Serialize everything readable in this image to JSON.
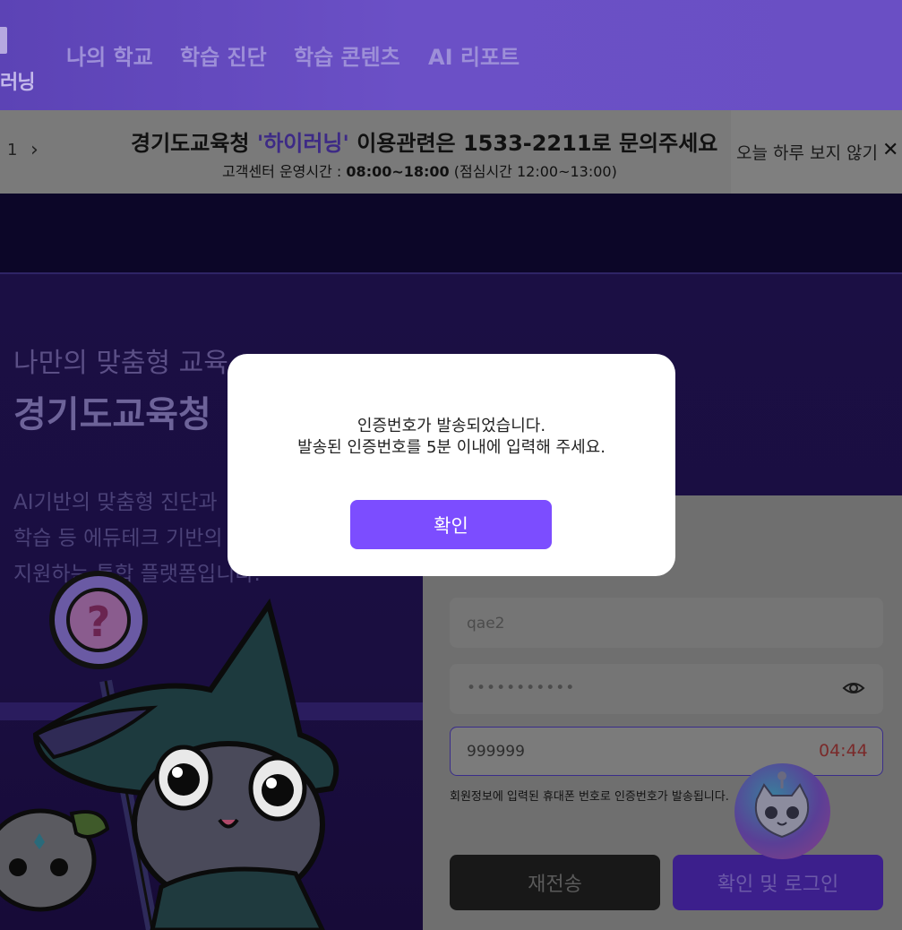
{
  "nav": {
    "logo_text": "러닝",
    "items": [
      "나의 학교",
      "학습 진단",
      "학습 콘텐츠",
      "AI 리포트"
    ]
  },
  "banner": {
    "page_indicator": "1",
    "next_icon": "chevron-right-icon",
    "title_prefix": "경기도교육청 ",
    "title_highlight": "'하이러닝'",
    "title_suffix": " 이용관련은 1533-2211로 문의주세요",
    "hours_label": "고객센터 운영시간 : ",
    "hours_value": "08:00~18:00",
    "hours_note": " (점심시간 12:00~13:00)",
    "dismiss_label": "오늘 하루 보지 않기",
    "close_icon": "close-icon"
  },
  "hero": {
    "subtitle": "나만의 맞춤형 교육",
    "title": "경기도교육청",
    "desc": [
      "AI기반의 맞춤형 진단과",
      "학습 등 에듀테크 기반의",
      "지원하는 통합 플랫폼입니다."
    ]
  },
  "login": {
    "id_value": "qae2",
    "password_mask": "•••••••••••",
    "code_value": "999999",
    "timer": "04:44",
    "hint": "회원정보에 입력된 휴대폰 번호로 인증번호가 발송됩니다.",
    "resend_label": "재전송",
    "submit_label": "확인 및 로그인"
  },
  "modal": {
    "line1": "인증번호가 발송되었습니다.",
    "line2": "발송된 인증번호를 5분 이내에 입력해 주세요.",
    "confirm_label": "확인"
  },
  "colors": {
    "nav_bg": "#6a4fc4",
    "accent": "#7c4dff",
    "timer": "#d04040"
  }
}
